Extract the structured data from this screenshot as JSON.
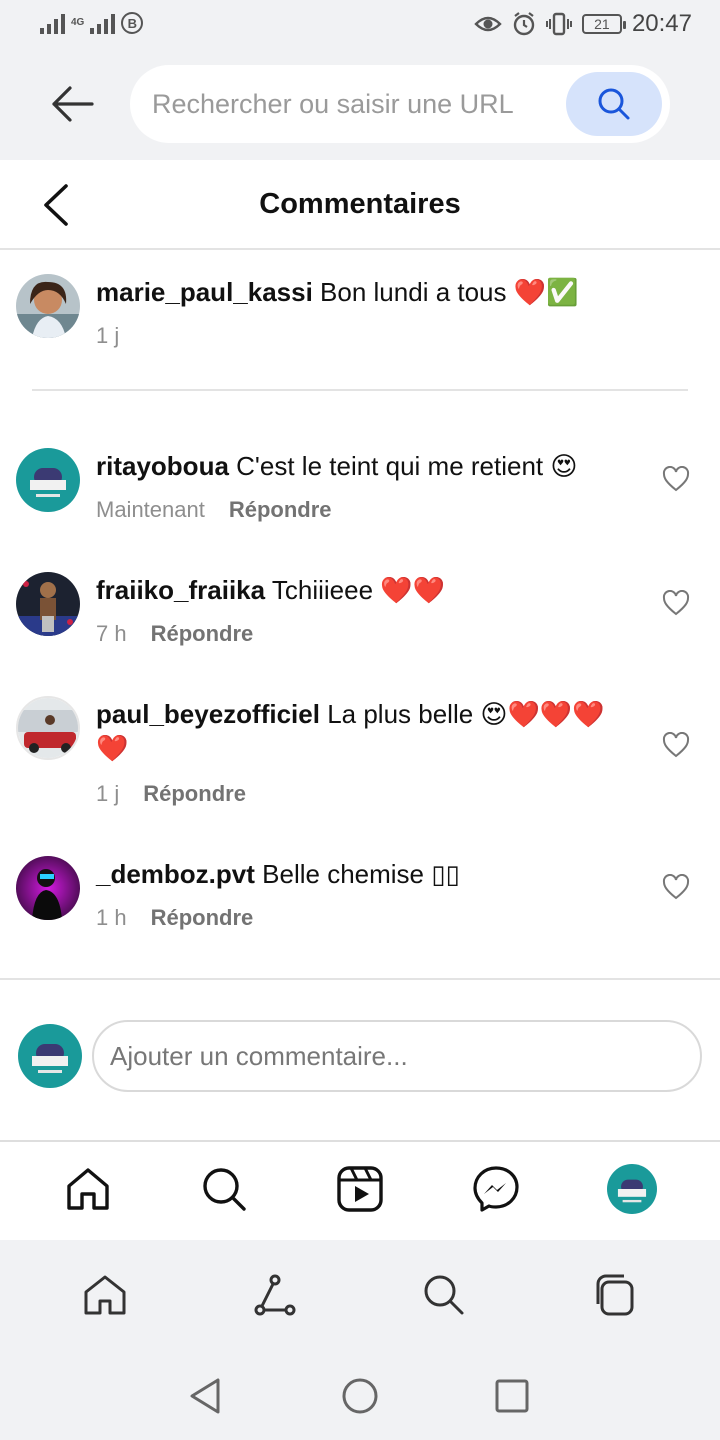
{
  "status_bar": {
    "network": "4G",
    "b_badge": "B",
    "battery": "21",
    "time": "20:47"
  },
  "browser": {
    "url_placeholder": "Rechercher ou saisir une URL"
  },
  "header": {
    "title": "Commentaires"
  },
  "caption": {
    "username": "marie_paul_kassi",
    "text": "Bon lundi a tous ❤️✅",
    "time": "1 j"
  },
  "comments": [
    {
      "username": "ritayoboua",
      "text": "C'est le teint qui me retient 😍",
      "time": "Maintenant",
      "reply": "Répondre"
    },
    {
      "username": "fraiiko_fraiika",
      "text": "Tchiiieee ❤️❤️",
      "time": "7 h",
      "reply": "Répondre"
    },
    {
      "username": "paul_beyezofficiel",
      "text": "La plus belle 😍❤️❤️❤️",
      "text_line2": "❤️",
      "time": "1 j",
      "reply": "Répondre"
    },
    {
      "username": "_demboz.pvt",
      "text": "Belle chemise ▯▯",
      "time": "1 h",
      "reply": "Répondre"
    }
  ],
  "comment_input": {
    "placeholder": "Ajouter un commentaire..."
  },
  "colors": {
    "teal_avatar": "#1a9a9a",
    "search_pill": "#d6e3fb",
    "heart_red": "#e0162b"
  }
}
